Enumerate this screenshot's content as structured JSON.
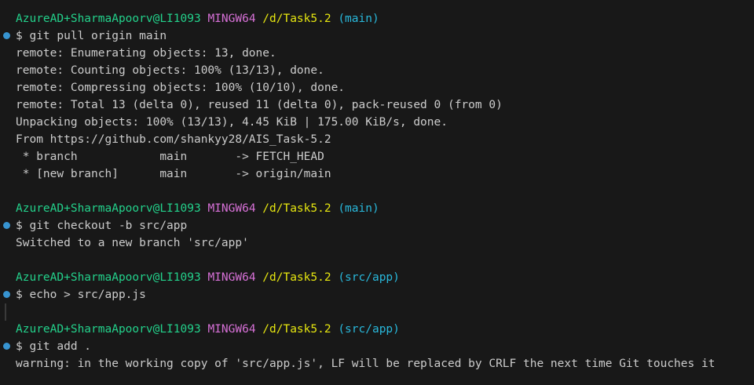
{
  "colors": {
    "background": "#181818",
    "text": "#cccccc",
    "prompt_user": "#23d18b",
    "prompt_system": "#d670d6",
    "prompt_path": "#e5e510",
    "prompt_branch": "#29b8db",
    "command_marker": "#3794d1"
  },
  "blocks": [
    {
      "prompt": {
        "user": "AzureAD+SharmaApoorv@LI1093",
        "system": "MINGW64",
        "path": "/d/Task5.2",
        "branch": "(main)"
      },
      "command": "$ git pull origin main",
      "output": [
        "remote: Enumerating objects: 13, done.",
        "remote: Counting objects: 100% (13/13), done.",
        "remote: Compressing objects: 100% (10/10), done.",
        "remote: Total 13 (delta 0), reused 11 (delta 0), pack-reused 0 (from 0)",
        "Unpacking objects: 100% (13/13), 4.45 KiB | 175.00 KiB/s, done.",
        "From https://github.com/shankyy28/AIS_Task-5.2",
        " * branch            main       -> FETCH_HEAD",
        " * [new branch]      main       -> origin/main"
      ]
    },
    {
      "prompt": {
        "user": "AzureAD+SharmaApoorv@LI1093",
        "system": "MINGW64",
        "path": "/d/Task5.2",
        "branch": "(main)"
      },
      "command": "$ git checkout -b src/app",
      "output": [
        "Switched to a new branch 'src/app'"
      ]
    },
    {
      "prompt": {
        "user": "AzureAD+SharmaApoorv@LI1093",
        "system": "MINGW64",
        "path": "/d/Task5.2",
        "branch": "(src/app)"
      },
      "command": "$ echo > src/app.js",
      "output": []
    },
    {
      "prompt": {
        "user": "AzureAD+SharmaApoorv@LI1093",
        "system": "MINGW64",
        "path": "/d/Task5.2",
        "branch": "(src/app)"
      },
      "command": "$ git add .",
      "output": [
        "warning: in the working copy of 'src/app.js', LF will be replaced by CRLF the next time Git touches it"
      ]
    }
  ]
}
